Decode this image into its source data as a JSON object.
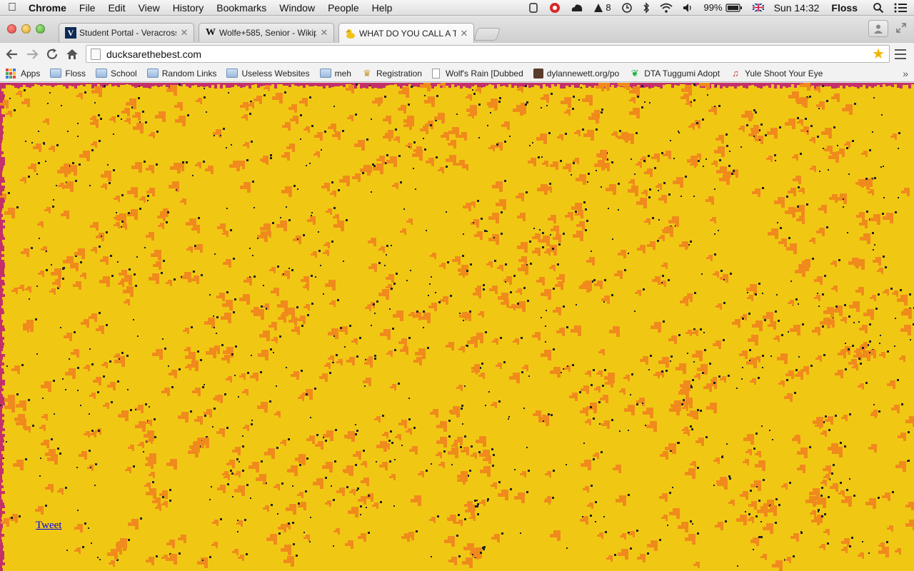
{
  "menubar": {
    "app_name": "Chrome",
    "items": [
      "File",
      "Edit",
      "View",
      "History",
      "Bookmarks",
      "Window",
      "People",
      "Help"
    ],
    "status": {
      "notifications_count": "8",
      "battery": "99%",
      "clock": "Sun 14:32",
      "user": "Floss"
    }
  },
  "tabs": [
    {
      "title": "Student Portal - Veracross",
      "favicon": "V",
      "active": false
    },
    {
      "title": "Wolfe+585, Senior - Wikip",
      "favicon": "W",
      "active": false
    },
    {
      "title": "WHAT DO YOU CALL A THE",
      "favicon": "duck-icon",
      "active": true
    }
  ],
  "toolbar": {
    "url": "ducksarethebest.com"
  },
  "bookmarks": [
    {
      "label": "Apps",
      "icon": "apps-icon"
    },
    {
      "label": "Floss",
      "icon": "folder-icon"
    },
    {
      "label": "School",
      "icon": "folder-icon"
    },
    {
      "label": "Random Links",
      "icon": "folder-icon"
    },
    {
      "label": "Useless Websites",
      "icon": "folder-icon"
    },
    {
      "label": "meh",
      "icon": "folder-icon"
    },
    {
      "label": "Registration",
      "icon": "registration-icon"
    },
    {
      "label": "Wolf's Rain [Dubbed",
      "icon": "page-icon"
    },
    {
      "label": "dylannewett.org/po",
      "icon": "avatar-icon"
    },
    {
      "label": "DTA Tuggumi Adopt",
      "icon": "dta-icon"
    },
    {
      "label": "Yule Shoot Your Eye",
      "icon": "guitar-icon"
    }
  ],
  "page": {
    "tweet_link": "Tweet"
  },
  "colors": {
    "page_background": "#f0c814",
    "pattern_orange": "#f08a1c",
    "pattern_dark": "#222222",
    "border_magenta": "#c4306a",
    "link_blue": "#0000ee"
  }
}
